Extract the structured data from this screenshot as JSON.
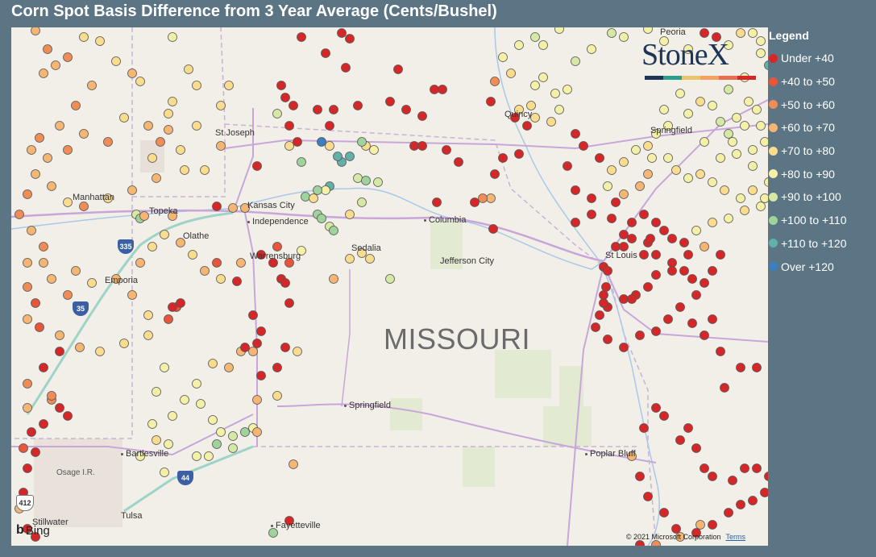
{
  "title": "Corn Spot Basis Difference from 3 Year Average (Cents/Bushel)",
  "legend": {
    "title": "Legend",
    "items": [
      {
        "label": "Under +40",
        "color": "#d62728"
      },
      {
        "label": "+40 to +50",
        "color": "#e8553a"
      },
      {
        "label": "+50 to +60",
        "color": "#f08c55"
      },
      {
        "label": "+60 to +70",
        "color": "#f5b573"
      },
      {
        "label": "+70 to +80",
        "color": "#fadc8f"
      },
      {
        "label": "+80 to +90",
        "color": "#f4f0a8"
      },
      {
        "label": "+90 to +100",
        "color": "#d6e9a4"
      },
      {
        "label": "+100 to +110",
        "color": "#9fd39b"
      },
      {
        "label": "+110 to +120",
        "color": "#62b0a8"
      },
      {
        "label": "Over +120",
        "color": "#3b7fbf"
      }
    ]
  },
  "logo": {
    "text": "StoneX",
    "bar_colors": [
      "#1d3557",
      "#2a9d8f",
      "#e9c46a",
      "#f4a261",
      "#e76f51",
      "#d62828"
    ]
  },
  "map": {
    "state_label": "MISSOURI",
    "cities": [
      "Peoria",
      "St Joseph",
      "Springfield",
      "Manhattan",
      "Topeka",
      "Kansas City",
      "Independence",
      "Olathe",
      "Columbia",
      "Quincy",
      "Sedalia",
      "Warrensburg",
      "Jefferson City",
      "St Louis",
      "Emporia",
      "Springfield",
      "Bartlesville",
      "Osage I.R.",
      "Poplar Bluff",
      "Stillwater",
      "Tulsa",
      "Fayetteville"
    ],
    "shields": [
      "335",
      "35",
      "44",
      "412"
    ],
    "attribution": "© 2021 Microsoft Corporation",
    "terms": "Terms",
    "provider": "Bing"
  }
}
